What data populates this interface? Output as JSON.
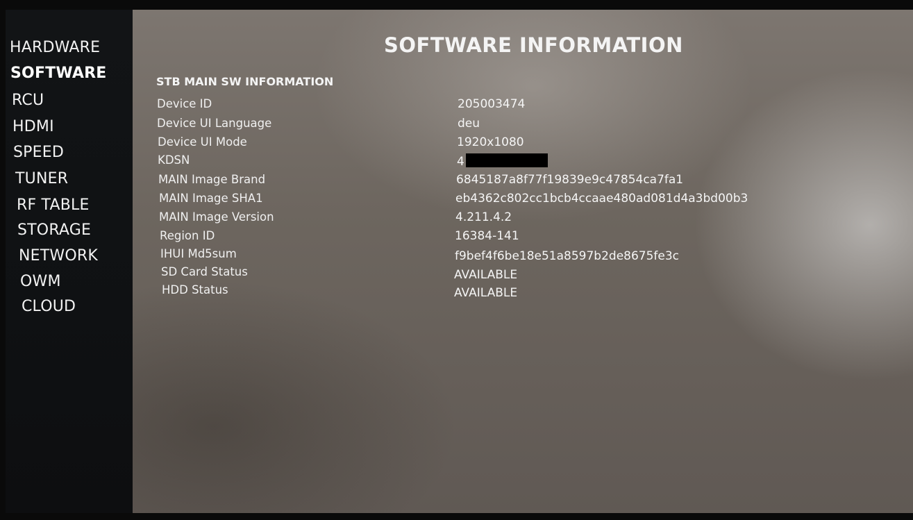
{
  "sidebar": {
    "items": [
      {
        "label": "HARDWARE"
      },
      {
        "label": "SOFTWARE",
        "active": true
      },
      {
        "label": "RCU"
      },
      {
        "label": "HDMI"
      },
      {
        "label": "SPEED"
      },
      {
        "label": "TUNER"
      },
      {
        "label": "RF TABLE"
      },
      {
        "label": "STORAGE"
      },
      {
        "label": "NETWORK"
      },
      {
        "label": "OWM"
      },
      {
        "label": "CLOUD"
      }
    ]
  },
  "main": {
    "title": "SOFTWARE INFORMATION",
    "section_title": "STB MAIN SW INFORMATION",
    "rows": [
      {
        "label": "Device ID",
        "value": "205003474"
      },
      {
        "label": "Device UI Language",
        "value": "deu"
      },
      {
        "label": "Device UI Mode",
        "value": "1920x1080"
      },
      {
        "label": "KDSN",
        "value": "4"
      },
      {
        "label": "MAIN Image Brand",
        "value": "6845187a8f77f19839e9c47854ca7fa1"
      },
      {
        "label": "MAIN Image SHA1",
        "value": "eb4362c802cc1bcb4ccaae480ad081d4a3bd00b3"
      },
      {
        "label": "MAIN Image Version",
        "value": "4.211.4.2"
      },
      {
        "label": "Region ID",
        "value": "16384-141"
      },
      {
        "label": "IHUI Md5sum",
        "value": "f9bef4f6be18e51a8597b2de8675fe3c"
      },
      {
        "label": "SD Card Status",
        "value": "AVAILABLE"
      },
      {
        "label": "HDD Status",
        "value": "AVAILABLE"
      }
    ]
  },
  "colors": {
    "sidebar_bg": "#121416",
    "screen_bg": "#7d7670",
    "text": "#f2f2f2"
  }
}
